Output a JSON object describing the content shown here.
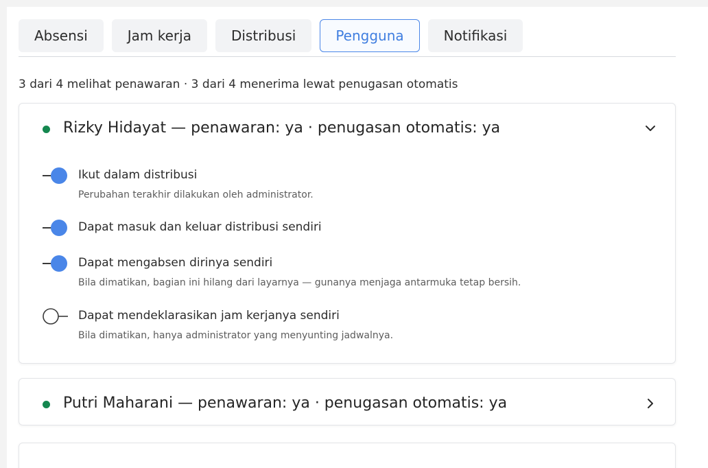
{
  "tabs": [
    {
      "label": "Absensi",
      "active": false
    },
    {
      "label": "Jam kerja",
      "active": false
    },
    {
      "label": "Distribusi",
      "active": false
    },
    {
      "label": "Pengguna",
      "active": true
    },
    {
      "label": "Notifikasi",
      "active": false
    }
  ],
  "summary": "3 dari 4 melihat penawaran · 3 dari 4 menerima lewat penugasan otomatis",
  "users": [
    {
      "title": "Rizky Hidayat — penawaran: ya · penugasan otomatis: ya",
      "status_color": "#14874f",
      "expanded": true,
      "settings": [
        {
          "label": "Ikut dalam distribusi",
          "description": "Perubahan terakhir dilakukan oleh administrator.",
          "on": true
        },
        {
          "label": "Dapat masuk dan keluar distribusi sendiri",
          "description": "",
          "on": true
        },
        {
          "label": "Dapat mengabsen dirinya sendiri",
          "description": "Bila dimatikan, bagian ini hilang dari layarnya — gunanya menjaga antarmuka tetap bersih.",
          "on": true
        },
        {
          "label": "Dapat mendeklarasikan jam kerjanya sendiri",
          "description": "Bila dimatikan, hanya administrator yang menyunting jadwalnya.",
          "on": false
        }
      ]
    },
    {
      "title": "Putri Maharani — penawaran: ya · penugasan otomatis: ya",
      "status_color": "#14874f",
      "expanded": false
    }
  ],
  "colors": {
    "accent": "#4a86e8",
    "status_green": "#14874f"
  },
  "icons": {
    "expanded_chevron": "chevron-down-icon",
    "collapsed_chevron": "chevron-right-icon"
  }
}
